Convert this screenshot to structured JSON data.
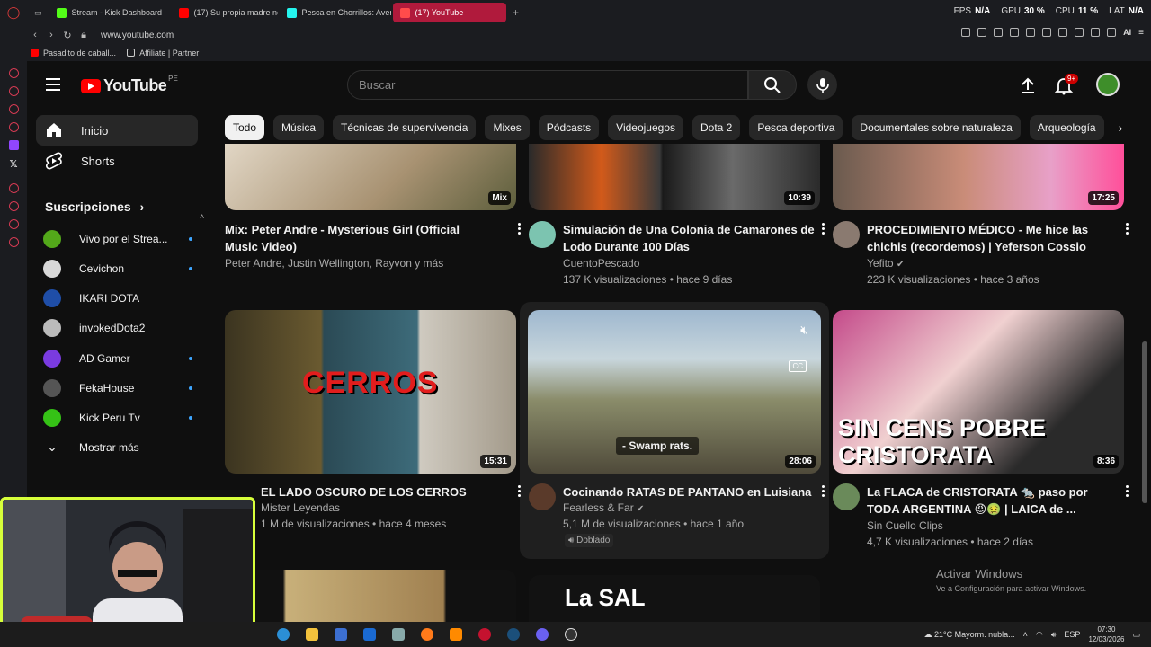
{
  "browser": {
    "tabs": [
      {
        "label": "Stream - Kick Dashboard",
        "color": "#53fc18"
      },
      {
        "label": "(17) Su propia madre no la",
        "color": "#ff0000"
      },
      {
        "label": "Pesca en Chorrillos: Aven",
        "color": "#25f4ee"
      },
      {
        "label": "(17) YouTube",
        "color": "#ff0000"
      }
    ],
    "stats": [
      {
        "label": "FPS",
        "value": "N/A"
      },
      {
        "label": "GPU",
        "value": "30 %"
      },
      {
        "label": "CPU",
        "value": "11 %"
      },
      {
        "label": "LAT",
        "value": "N/A"
      }
    ],
    "url": "www.youtube.com",
    "bookmarks": [
      "Pasadito de caball...",
      "Affiliate | Partner"
    ],
    "ai_label": "AI"
  },
  "youtube": {
    "logo_text": "YouTube",
    "country_code": "PE",
    "search_placeholder": "Buscar",
    "notif_badge": "9+",
    "accent": "#ff0000"
  },
  "sidebar": {
    "home": "Inicio",
    "shorts": "Shorts",
    "subscriptions_header": "Suscripciones",
    "subscriptions": [
      {
        "label": "Vivo por el Strea...",
        "color": "#53a81a",
        "new": true
      },
      {
        "label": "Cevichon",
        "color": "#d8d8d8",
        "new": true
      },
      {
        "label": "IKARI DOTA",
        "color": "#1f4ea8",
        "new": false
      },
      {
        "label": "invokedDota2",
        "color": "#bbbbbb",
        "new": false
      },
      {
        "label": "AD Gamer",
        "color": "#7a3be0",
        "new": true
      },
      {
        "label": "FekaHouse",
        "color": "#555555",
        "new": true
      },
      {
        "label": "Kick Peru Tv",
        "color": "#35c216",
        "new": true
      }
    ],
    "show_more": "Mostrar más"
  },
  "chips": [
    "Todo",
    "Música",
    "Técnicas de supervivencia",
    "Mixes",
    "Pódcasts",
    "Videojuegos",
    "Dota 2",
    "Pesca deportiva",
    "Documentales sobre naturaleza",
    "Arqueología"
  ],
  "videos": [
    {
      "title": "Mix: Peter Andre - Mysterious Girl (Official Music Video)",
      "channel": "Peter Andre, Justin Wellington, Rayvon y más",
      "meta": "",
      "duration": "Mix",
      "verified": false
    },
    {
      "title": "Simulación de Una Colonia de Camarones de Lodo Durante 100 Días",
      "channel": "CuentoPescado",
      "meta": "137 K visualizaciones • hace 9 días",
      "duration": "10:39",
      "verified": false
    },
    {
      "title": "PROCEDIMIENTO MÉDICO - Me hice las chichis (recordemos)   | Yeferson Cossio",
      "channel": "Yefito",
      "meta": "223 K visualizaciones • hace 3 años",
      "duration": "17:25",
      "verified": true
    },
    {
      "title": "EL LADO OSCURO DE LOS CERROS",
      "channel": "Mister Leyendas",
      "meta": "1 M de visualizaciones • hace 4 meses",
      "duration": "15:31",
      "verified": false,
      "overlay": "CERROS"
    },
    {
      "title": "Cocinando RATAS DE PANTANO en Luisiana",
      "channel": "Fearless & Far",
      "meta": "5,1 M de visualizaciones • hace 1 año",
      "duration": "28:06",
      "verified": true,
      "caption": "- Swamp rats.",
      "dubbed": "Doblado"
    },
    {
      "title": "La FLACA de CRISTORATA 🐀 paso por TODA ARGENTINA 😡🤢 | LAICA de ...",
      "channel": "Sin Cuello Clips",
      "meta": "4,7 K visualizaciones • hace 2 días",
      "duration": "8:36",
      "verified": false,
      "overlay": "SIN CENS POBRE CRISTORATA"
    }
  ],
  "next_row": {
    "overlay": "La SAL"
  },
  "windows_watermark": {
    "line1": "Activar Windows",
    "line2": "Ve a Configuración para activar Windows."
  },
  "taskbar": {
    "weather": "21°C  Mayorm. nubla...",
    "lang": "ESP",
    "time": "07:30",
    "date": "12/03/2026"
  }
}
